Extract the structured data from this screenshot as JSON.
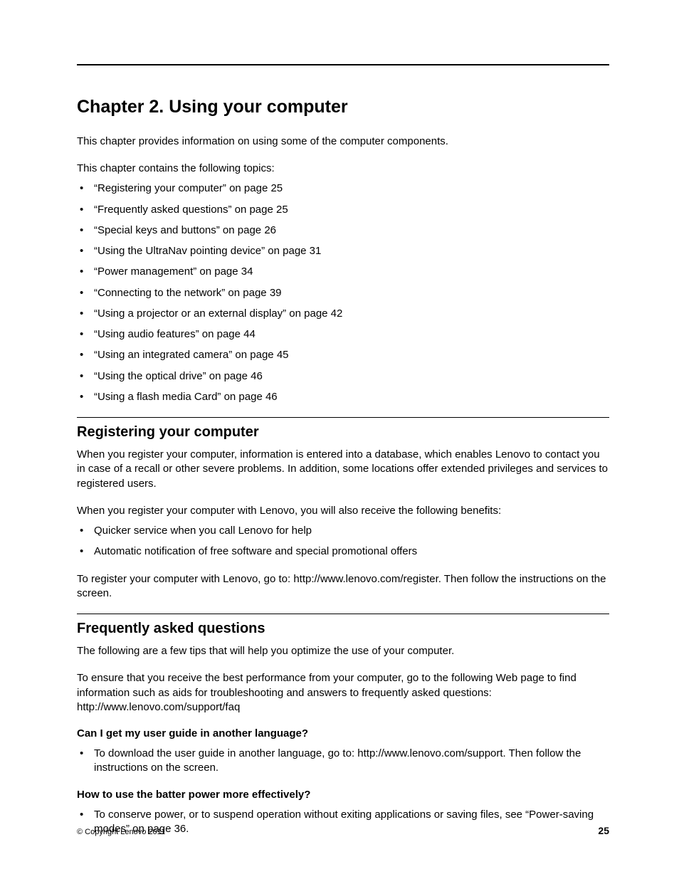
{
  "chapter": {
    "title": "Chapter 2.   Using your computer",
    "intro": "This chapter provides information on using some of the computer components.",
    "topics_intro": "This chapter contains the following topics:",
    "topics": [
      "“Registering your computer” on page 25",
      "“Frequently asked questions” on page 25",
      "“Special keys and buttons” on page 26",
      "“Using the UltraNav pointing device” on page 31",
      "“Power management” on page 34",
      "“Connecting to the network” on page 39",
      "“Using a projector or an external display” on page 42",
      "“Using audio features” on page 44",
      "“Using an integrated camera” on page 45",
      "“Using the optical drive” on page 46",
      "“Using a flash media Card” on page 46"
    ]
  },
  "sections": {
    "registering": {
      "title": "Registering your computer",
      "para1": "When you register your computer, information is entered into a database, which enables Lenovo to contact you in case of a recall or other severe problems. In addition, some locations offer extended privileges and services to registered users.",
      "para2": "When you register your computer with Lenovo, you will also receive the following benefits:",
      "benefits": [
        "Quicker service when you call Lenovo for help",
        "Automatic notification of free software and special promotional offers"
      ],
      "para3": "To register your computer with Lenovo, go to: http://www.lenovo.com/register. Then follow the instructions on the screen."
    },
    "faq": {
      "title": "Frequently asked questions",
      "para1": "The following are a few tips that will help you optimize the use of your computer.",
      "para2": "To ensure that you receive the best performance from your computer, go to the following Web page to find information such as aids for troubleshooting and answers to frequently asked questions: http://www.lenovo.com/support/faq",
      "q1": {
        "question": "Can I get my user guide in another language?",
        "answer": "To download the user guide in another language, go to: http://www.lenovo.com/support. Then follow the instructions on the screen."
      },
      "q2": {
        "question": "How to use the batter power more effectively?",
        "answer": "To conserve power, or to suspend operation without exiting applications or saving files, see “Power-saving modes” on page 36."
      }
    }
  },
  "footer": {
    "copyright": "© Copyright Lenovo 2011",
    "page": "25"
  }
}
